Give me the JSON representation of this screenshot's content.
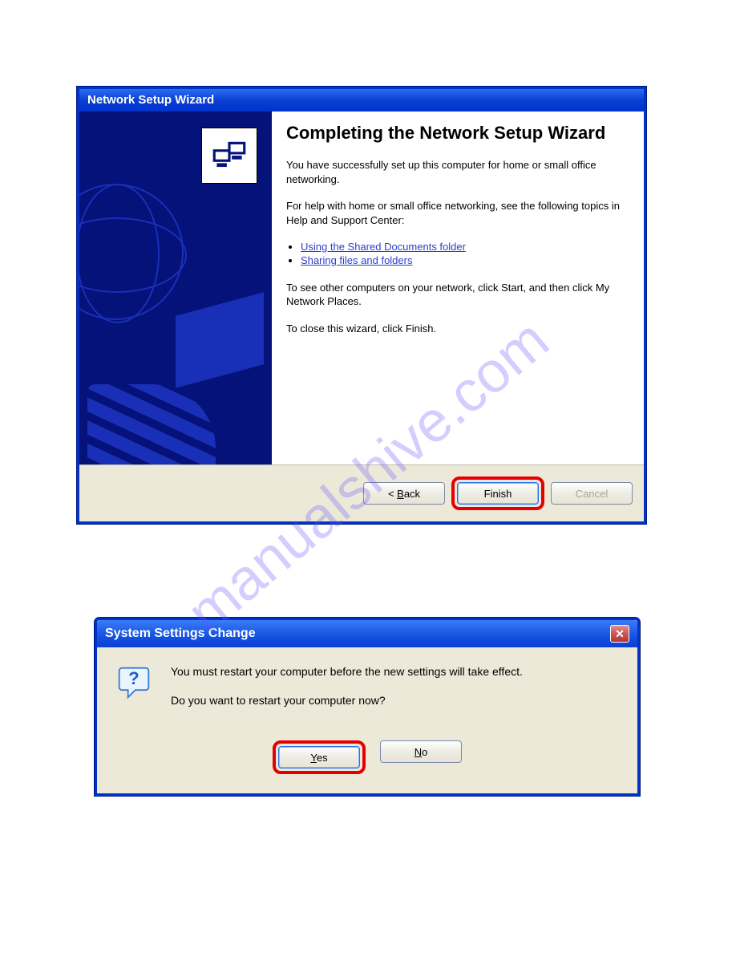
{
  "watermark": "manualshive.com",
  "wizard": {
    "title": "Network Setup Wizard",
    "heading": "Completing the Network Setup Wizard",
    "para1": "You have successfully set up this computer for home or small office networking.",
    "para2": "For help with home or small office networking, see the following topics in Help and Support Center:",
    "links": {
      "shared_docs": "Using the Shared Documents folder",
      "sharing": "Sharing files and folders"
    },
    "para3": "To see other computers on your network, click Start, and then click My Network Places.",
    "close_line": "To close this wizard, click Finish.",
    "buttons": {
      "back": "< Back",
      "finish": "Finish",
      "cancel": "Cancel"
    }
  },
  "msgbox": {
    "title": "System Settings Change",
    "line1": "You must restart your computer before the new settings will take effect.",
    "line2": "Do you want to restart your computer now?",
    "buttons": {
      "yes": "Yes",
      "no": "No"
    }
  }
}
